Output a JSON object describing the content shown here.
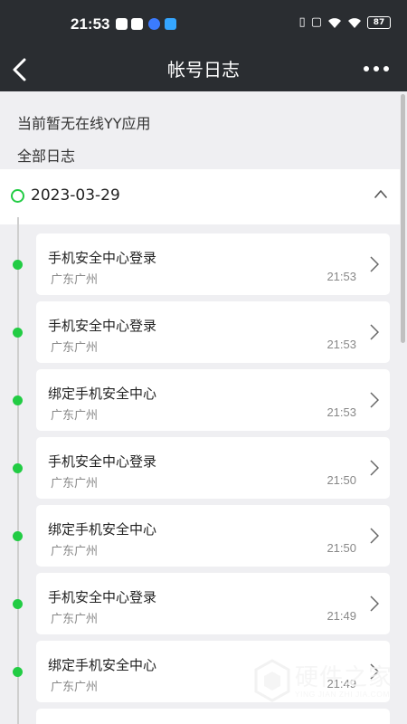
{
  "status_bar": {
    "time": "21:53",
    "battery": "87"
  },
  "header": {
    "title": "帐号日志"
  },
  "notice": {
    "no_app_online": "当前暂无在线YY应用",
    "all_logs": "全部日志"
  },
  "log_group": {
    "date": "2023-03-29"
  },
  "logs": [
    {
      "name": "手机安全中心登录",
      "location": "广东广州",
      "time": "21:53"
    },
    {
      "name": "手机安全中心登录",
      "location": "广东广州",
      "time": "21:53"
    },
    {
      "name": "绑定手机安全中心",
      "location": "广东广州",
      "time": "21:53"
    },
    {
      "name": "手机安全中心登录",
      "location": "广东广州",
      "time": "21:50"
    },
    {
      "name": "绑定手机安全中心",
      "location": "广东广州",
      "time": "21:50"
    },
    {
      "name": "手机安全中心登录",
      "location": "广东广州",
      "time": "21:49"
    },
    {
      "name": "绑定手机安全中心",
      "location": "广东广州",
      "time": "21:49"
    }
  ],
  "watermark": {
    "main": "硬件之家",
    "sub": "YING JIAN ZHI JIA.COM"
  },
  "colors": {
    "header_bg": "#2a2d31",
    "accent_green": "#22cc44",
    "page_bg": "#efeff2"
  },
  "icons": [
    "back-arrow-icon",
    "more-dots-icon",
    "chevron-up-icon",
    "chevron-right-icon",
    "wifi-icon",
    "battery-icon",
    "vibrate-icon"
  ]
}
